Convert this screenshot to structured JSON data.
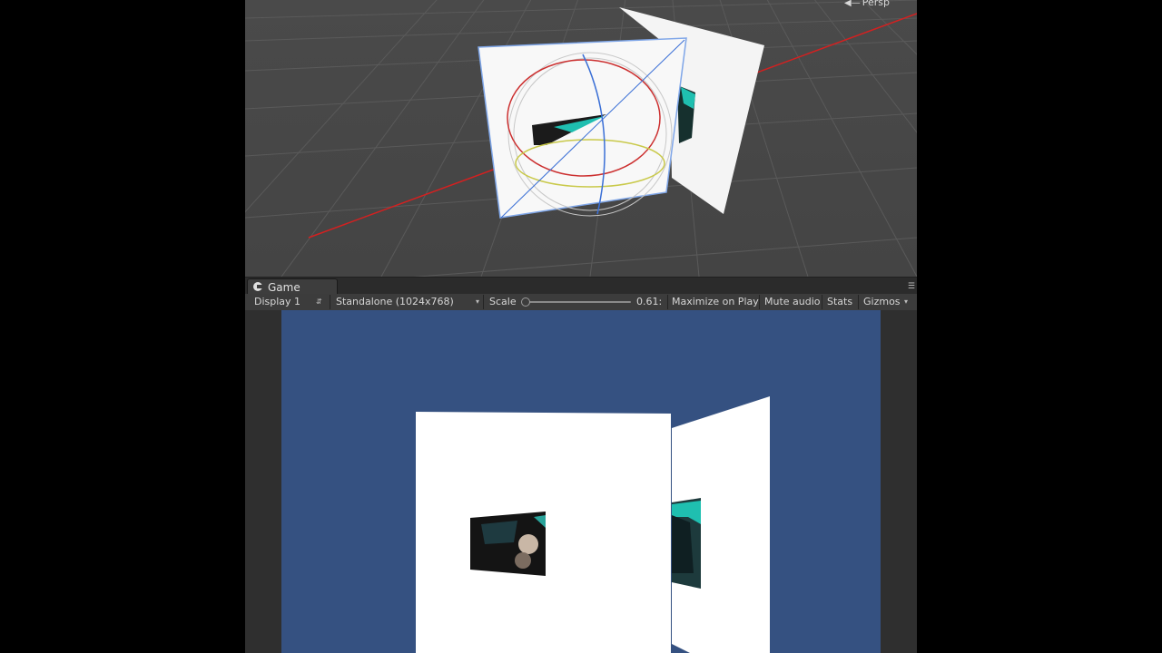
{
  "scene_view": {
    "camera_mode": "Persp"
  },
  "game_window": {
    "tab_label": "Game",
    "toolbar": {
      "display": "Display 1",
      "resolution": "Standalone (1024x768)",
      "scale_label": "Scale",
      "scale_value": "0.61:",
      "maximize_on_play": "Maximize on Play",
      "mute_audio": "Mute audio",
      "stats": "Stats",
      "gizmos": "Gizmos"
    }
  },
  "colors": {
    "editor_bg": "#474747",
    "game_bg": "#355181",
    "x_axis": "#d42020",
    "video_accent": "#1fbfb0"
  },
  "icons": {
    "game_tab": "pacman-game-icon",
    "persp": "back-arrow-icon",
    "dropdown": "chevron-down-icon"
  }
}
